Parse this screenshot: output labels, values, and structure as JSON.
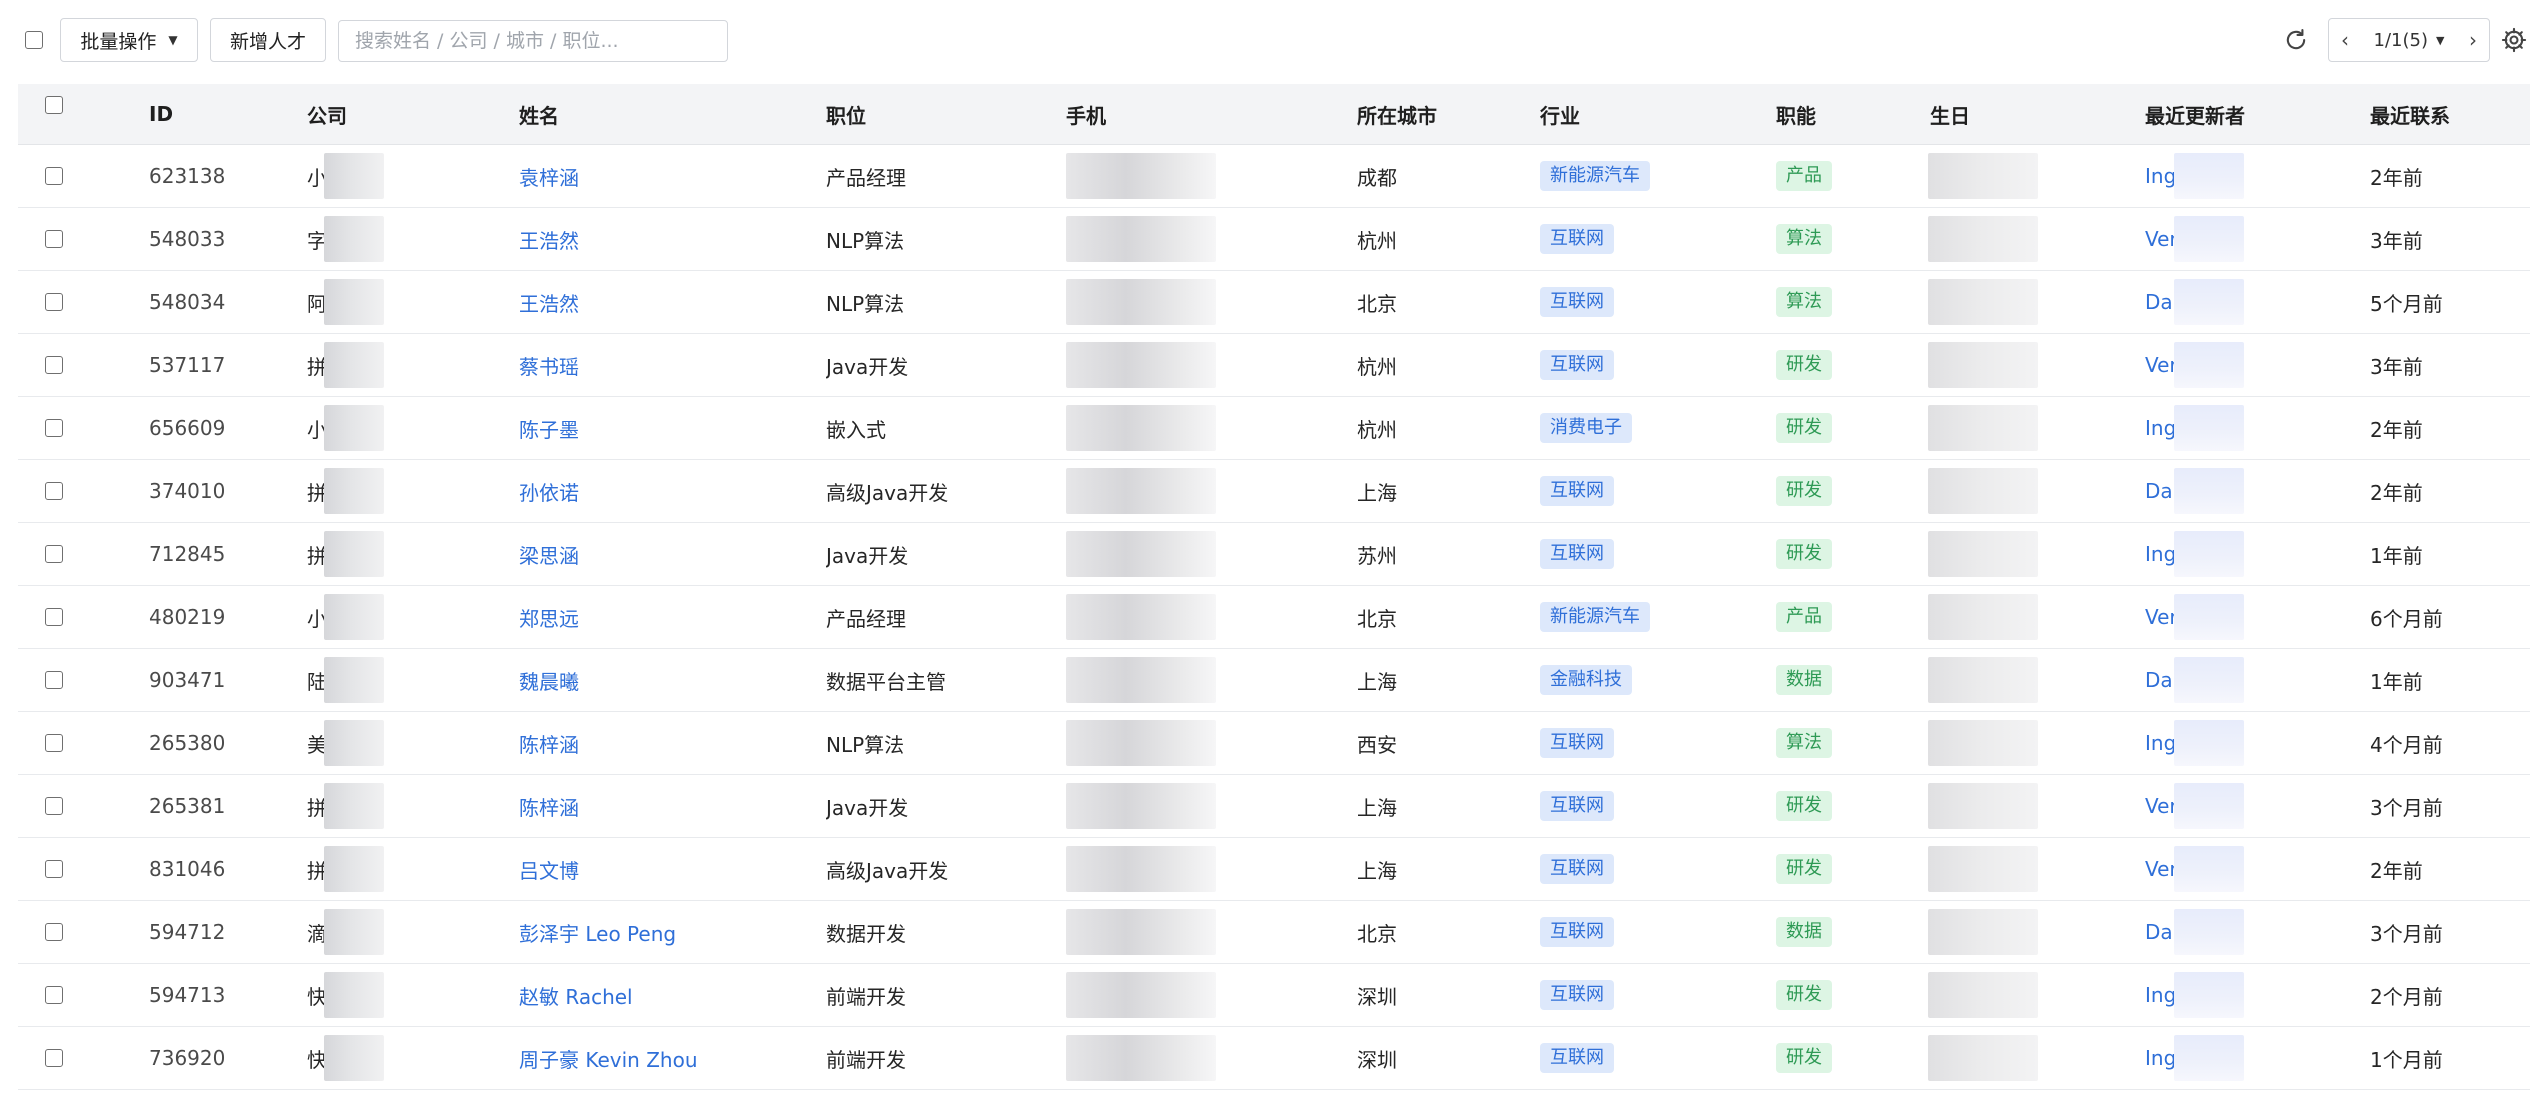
{
  "toolbar": {
    "batch_label": "批量操作",
    "add_label": "新增人才",
    "search_placeholder": "搜索姓名 / 公司 / 城市 / 职位...",
    "pager_text": "1/1(5)",
    "prev_icon": "chevron-left-icon",
    "next_icon": "chevron-right-icon",
    "refresh_icon": "refresh-icon",
    "settings_icon": "gear-icon"
  },
  "colors": {
    "link": "#2f6fd8",
    "industry_tag_bg": "#dde8fb",
    "function_tag_bg": "#ddf5e4",
    "function_tag_text": "#2e9a55",
    "header_bg": "#f3f4f6"
  },
  "table": {
    "headers": {
      "id": "ID",
      "company": "公司",
      "name": "姓名",
      "position": "职位",
      "phone": "手机",
      "city": "所在城市",
      "industry": "行业",
      "function": "职能",
      "birthday": "生日",
      "updater": "最近更新者",
      "contact": "最近联系"
    },
    "rows": [
      {
        "id": "623138",
        "company": "小",
        "name": "袁梓涵",
        "position": "产品经理",
        "city": "成都",
        "industry": "新能源汽车",
        "function": "产品",
        "updater": "Ing",
        "contact": "2年前"
      },
      {
        "id": "548033",
        "company": "字",
        "name": "王浩然",
        "position": "NLP算法",
        "city": "杭州",
        "industry": "互联网",
        "function": "算法",
        "updater": "Ver",
        "contact": "3年前"
      },
      {
        "id": "548034",
        "company": "阿",
        "name": "王浩然",
        "position": "NLP算法",
        "city": "北京",
        "industry": "互联网",
        "function": "算法",
        "updater": "Dai",
        "contact": "5个月前"
      },
      {
        "id": "537117",
        "company": "拼",
        "name": "蔡书瑶",
        "position": "Java开发",
        "city": "杭州",
        "industry": "互联网",
        "function": "研发",
        "updater": "Ver",
        "contact": "3年前"
      },
      {
        "id": "656609",
        "company": "小",
        "name": "陈子墨",
        "position": "嵌入式",
        "city": "杭州",
        "industry": "消费电子",
        "function": "研发",
        "updater": "Ing",
        "contact": "2年前"
      },
      {
        "id": "374010",
        "company": "拼",
        "name": "孙依诺",
        "position": "高级Java开发",
        "city": "上海",
        "industry": "互联网",
        "function": "研发",
        "updater": "Dai",
        "contact": "2年前"
      },
      {
        "id": "712845",
        "company": "拼",
        "name": "梁思涵",
        "position": "Java开发",
        "city": "苏州",
        "industry": "互联网",
        "function": "研发",
        "updater": "Ing",
        "contact": "1年前"
      },
      {
        "id": "480219",
        "company": "小",
        "name": "郑思远",
        "position": "产品经理",
        "city": "北京",
        "industry": "新能源汽车",
        "function": "产品",
        "updater": "Ver",
        "contact": "6个月前"
      },
      {
        "id": "903471",
        "company": "陆",
        "name": "魏晨曦",
        "position": "数据平台主管",
        "city": "上海",
        "industry": "金融科技",
        "function": "数据",
        "updater": "Dai",
        "contact": "1年前"
      },
      {
        "id": "265380",
        "company": "美",
        "name": "陈梓涵",
        "position": "NLP算法",
        "city": "西安",
        "industry": "互联网",
        "function": "算法",
        "updater": "Ing",
        "contact": "4个月前"
      },
      {
        "id": "265381",
        "company": "拼",
        "name": "陈梓涵",
        "position": "Java开发",
        "city": "上海",
        "industry": "互联网",
        "function": "研发",
        "updater": "Ver",
        "contact": "3个月前"
      },
      {
        "id": "831046",
        "company": "拼",
        "name": "吕文博",
        "position": "高级Java开发",
        "city": "上海",
        "industry": "互联网",
        "function": "研发",
        "updater": "Ver",
        "contact": "2年前"
      },
      {
        "id": "594712",
        "company": "滴",
        "name": "彭泽宇 Leo Peng",
        "position": "数据开发",
        "city": "北京",
        "industry": "互联网",
        "function": "数据",
        "updater": "Dai",
        "contact": "3个月前"
      },
      {
        "id": "594713",
        "company": "快",
        "name": "赵敏 Rachel",
        "position": "前端开发",
        "city": "深圳",
        "industry": "互联网",
        "function": "研发",
        "updater": "Ing",
        "contact": "2个月前"
      },
      {
        "id": "736920",
        "company": "快",
        "name": "周子豪 Kevin Zhou",
        "position": "前端开发",
        "city": "深圳",
        "industry": "互联网",
        "function": "研发",
        "updater": "Ing",
        "contact": "1个月前"
      }
    ]
  }
}
